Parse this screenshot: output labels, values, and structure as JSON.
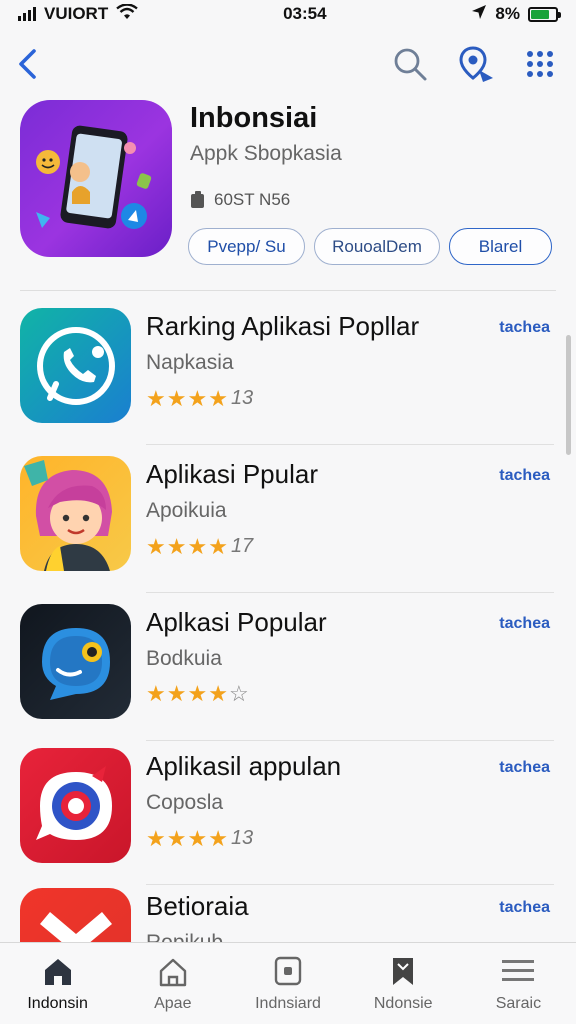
{
  "status_bar": {
    "carrier": "VUIORT",
    "time": "03:54",
    "battery_text": "8%"
  },
  "nav": {
    "back_icon": "chevron-left-icon",
    "search_icon": "search-icon",
    "location_icon": "location-pin-icon",
    "grid_icon": "grid-icon"
  },
  "header_app": {
    "title": "Inbonsiai",
    "subtitle": "Appk Sbopkasia",
    "meta": "60ST N56",
    "buttons": [
      "Pvepp/ Su",
      "RouoalDem",
      "Blarel"
    ]
  },
  "apps": [
    {
      "title": "Rarking Aplikasi Popllar",
      "subtitle": "Napkasia",
      "stars": 4,
      "rating_text": "13",
      "action": "tachea"
    },
    {
      "title": "Aplikasi Ppular",
      "subtitle": "Apoikuia",
      "stars": 4,
      "rating_text": "17",
      "action": "tachea"
    },
    {
      "title": "Aplkasi Popular",
      "subtitle": "Bodkuia",
      "stars": 4,
      "rating_text": "",
      "action": "tachea"
    },
    {
      "title": "Aplikasil appulan",
      "subtitle": "Coposla",
      "stars": 4,
      "rating_text": "13",
      "action": "tachea"
    },
    {
      "title": "Betioraia",
      "subtitle": "Ropikub",
      "stars": 0,
      "rating_text": "",
      "action": "tachea"
    }
  ],
  "tabs": [
    {
      "label": "Indonsin",
      "icon": "home-icon"
    },
    {
      "label": "Apae",
      "icon": "house-outline-icon"
    },
    {
      "label": "Indnsiard",
      "icon": "box-icon"
    },
    {
      "label": "Ndonsie",
      "icon": "bookmark-icon"
    },
    {
      "label": "Saraic",
      "icon": "menu-icon"
    }
  ],
  "colors": {
    "accent": "#2b5cc0",
    "star": "#f3a21c",
    "hero_icon": "#8a2ed9"
  }
}
